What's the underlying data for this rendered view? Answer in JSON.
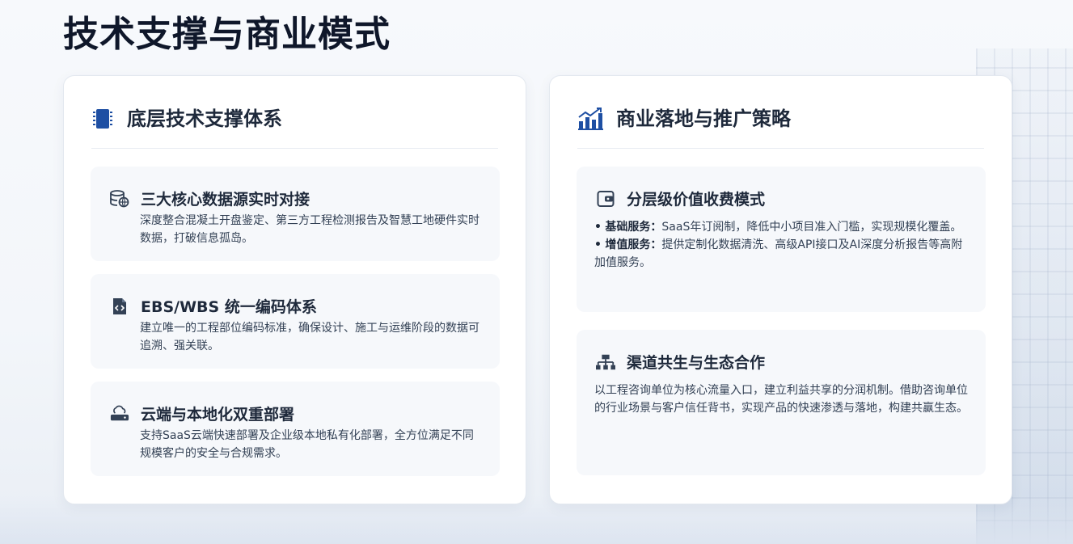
{
  "page": {
    "title": "技术支撑与商业模式"
  },
  "left_panel": {
    "title": "底层技术支撑体系",
    "icon": "chip-icon",
    "cards": [
      {
        "icon": "database-icon",
        "title": "三大核心数据源实时对接",
        "desc": "深度整合混凝土开盘鉴定、第三方工程检测报告及智慧工地硬件实时数据，打破信息孤岛。"
      },
      {
        "icon": "code-file-icon",
        "title": "EBS/WBS 统一编码体系",
        "desc": "建立唯一的工程部位编码标准，确保设计、施工与运维阶段的数据可追溯、强关联。"
      },
      {
        "icon": "cloud-server-icon",
        "title": "云端与本地化双重部署",
        "desc": "支持SaaS云端快速部署及企业级本地私有化部署，全方位满足不同规模客户的安全与合规需求。"
      }
    ]
  },
  "right_panel": {
    "title": "商业落地与推广策略",
    "icon": "bar-chart-icon",
    "cards": [
      {
        "icon": "wallet-icon",
        "title": "分层级价值收费模式",
        "bullets": [
          {
            "marker": "•",
            "label": "基础服务：",
            "text": "SaaS年订阅制，降低中小项目准入门槛，实现规模化覆盖。"
          },
          {
            "marker": "•",
            "label": "增值服务：",
            "text": "提供定制化数据清洗、高级API接口及AI深度分析报告等高附加值服务。"
          }
        ]
      },
      {
        "icon": "sitemap-icon",
        "title": "渠道共生与生态合作",
        "desc": "以工程咨询单位为核心流量入口，建立利益共享的分润机制。借助咨询单位的行业场景与客户信任背书，实现产品的快速渗透与落地，构建共赢生态。"
      }
    ]
  },
  "colors": {
    "accent": "#1e4fa3",
    "icon_dark": "#334155",
    "card_bg": "#f6f8fb"
  }
}
